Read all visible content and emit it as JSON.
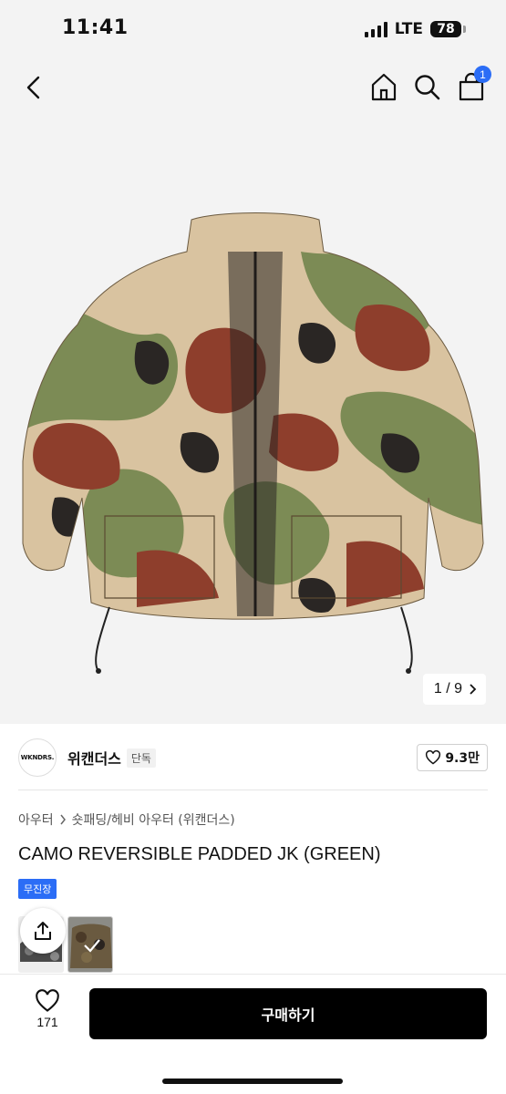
{
  "status_bar": {
    "time": "11:41",
    "network": "LTE",
    "battery": "78"
  },
  "header": {
    "cart_count": "1",
    "icons": [
      "back-icon",
      "home-icon",
      "search-icon",
      "shopping-bag-icon"
    ]
  },
  "gallery": {
    "counter": "1 / 9"
  },
  "brand": {
    "logo_text": "WKNDRS.",
    "name": "위캔더스",
    "tag": "단독",
    "likes": "9.3만"
  },
  "breadcrumb": {
    "parent": "아우터",
    "child": "숏패딩/헤비 아우터 (위캔더스)"
  },
  "product": {
    "title": "CAMO REVERSIBLE PADDED JK (GREEN)",
    "badge": "무진장"
  },
  "bottom_bar": {
    "wish_count": "171",
    "buy_label": "구매하기"
  },
  "colors": {
    "accent": "#2b6df6",
    "buy_button": "#000000",
    "background": "#f3f3f3"
  }
}
